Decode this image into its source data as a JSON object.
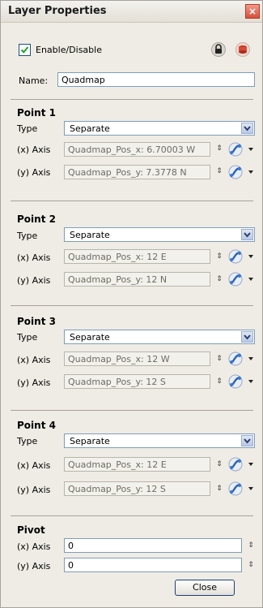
{
  "window": {
    "title": "Layer Properties",
    "close_glyph": "×"
  },
  "header": {
    "enable_label": "Enable/Disable",
    "enabled": true,
    "lock_icon": "lock-icon",
    "layer_icon": "layer-color-icon"
  },
  "name": {
    "label": "Name:",
    "value": "Quadmap"
  },
  "points": [
    {
      "title": "Point 1",
      "type_label": "Type",
      "type_value": "Separate",
      "x_label": "(x) Axis",
      "x_value": "Quadmap_Pos_x: 6.70003 W",
      "y_label": "(y) Axis",
      "y_value": "Quadmap_Pos_y: 7.3778 N"
    },
    {
      "title": "Point 2",
      "type_label": "Type",
      "type_value": "Separate",
      "x_label": "(x) Axis",
      "x_value": "Quadmap_Pos_x: 12 E",
      "y_label": "(y) Axis",
      "y_value": "Quadmap_Pos_y: 12 N"
    },
    {
      "title": "Point 3",
      "type_label": "Type",
      "type_value": "Separate",
      "x_label": "(x) Axis",
      "x_value": "Quadmap_Pos_x: 12 W",
      "y_label": "(y) Axis",
      "y_value": "Quadmap_Pos_y: 12 S"
    },
    {
      "title": "Point 4",
      "type_label": "Type",
      "type_value": "Separate",
      "x_label": "(x) Axis",
      "x_value": "Quadmap_Pos_x: 12 E",
      "y_label": "(y) Axis",
      "y_value": "Quadmap_Pos_y: 12 S"
    }
  ],
  "pivot": {
    "title": "Pivot",
    "x_label": "(x) Axis",
    "x_value": "0",
    "y_label": "(y) Axis",
    "y_value": "0"
  },
  "footer": {
    "close_label": "Close"
  },
  "colors": {
    "accent": "#1d3f7a",
    "window_bg": "#efece5",
    "input_border": "#7f9db9"
  }
}
